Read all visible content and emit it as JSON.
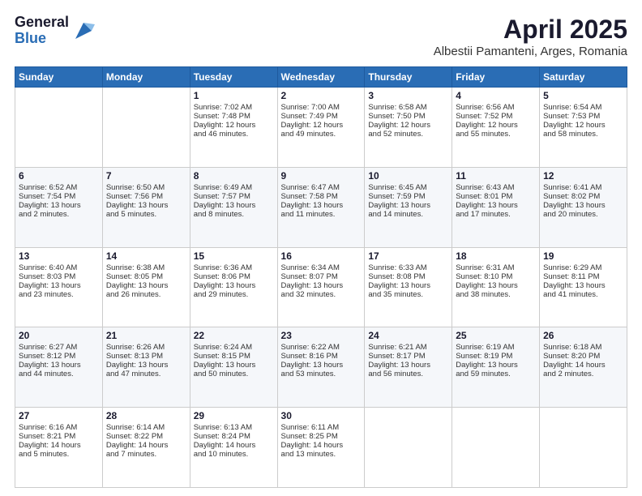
{
  "logo": {
    "general": "General",
    "blue": "Blue"
  },
  "header": {
    "title": "April 2025",
    "subtitle": "Albestii Pamanteni, Arges, Romania"
  },
  "weekdays": [
    "Sunday",
    "Monday",
    "Tuesday",
    "Wednesday",
    "Thursday",
    "Friday",
    "Saturday"
  ],
  "weeks": [
    [
      {
        "day": "",
        "info": ""
      },
      {
        "day": "",
        "info": ""
      },
      {
        "day": "1",
        "info": "Sunrise: 7:02 AM\nSunset: 7:48 PM\nDaylight: 12 hours\nand 46 minutes."
      },
      {
        "day": "2",
        "info": "Sunrise: 7:00 AM\nSunset: 7:49 PM\nDaylight: 12 hours\nand 49 minutes."
      },
      {
        "day": "3",
        "info": "Sunrise: 6:58 AM\nSunset: 7:50 PM\nDaylight: 12 hours\nand 52 minutes."
      },
      {
        "day": "4",
        "info": "Sunrise: 6:56 AM\nSunset: 7:52 PM\nDaylight: 12 hours\nand 55 minutes."
      },
      {
        "day": "5",
        "info": "Sunrise: 6:54 AM\nSunset: 7:53 PM\nDaylight: 12 hours\nand 58 minutes."
      }
    ],
    [
      {
        "day": "6",
        "info": "Sunrise: 6:52 AM\nSunset: 7:54 PM\nDaylight: 13 hours\nand 2 minutes."
      },
      {
        "day": "7",
        "info": "Sunrise: 6:50 AM\nSunset: 7:56 PM\nDaylight: 13 hours\nand 5 minutes."
      },
      {
        "day": "8",
        "info": "Sunrise: 6:49 AM\nSunset: 7:57 PM\nDaylight: 13 hours\nand 8 minutes."
      },
      {
        "day": "9",
        "info": "Sunrise: 6:47 AM\nSunset: 7:58 PM\nDaylight: 13 hours\nand 11 minutes."
      },
      {
        "day": "10",
        "info": "Sunrise: 6:45 AM\nSunset: 7:59 PM\nDaylight: 13 hours\nand 14 minutes."
      },
      {
        "day": "11",
        "info": "Sunrise: 6:43 AM\nSunset: 8:01 PM\nDaylight: 13 hours\nand 17 minutes."
      },
      {
        "day": "12",
        "info": "Sunrise: 6:41 AM\nSunset: 8:02 PM\nDaylight: 13 hours\nand 20 minutes."
      }
    ],
    [
      {
        "day": "13",
        "info": "Sunrise: 6:40 AM\nSunset: 8:03 PM\nDaylight: 13 hours\nand 23 minutes."
      },
      {
        "day": "14",
        "info": "Sunrise: 6:38 AM\nSunset: 8:05 PM\nDaylight: 13 hours\nand 26 minutes."
      },
      {
        "day": "15",
        "info": "Sunrise: 6:36 AM\nSunset: 8:06 PM\nDaylight: 13 hours\nand 29 minutes."
      },
      {
        "day": "16",
        "info": "Sunrise: 6:34 AM\nSunset: 8:07 PM\nDaylight: 13 hours\nand 32 minutes."
      },
      {
        "day": "17",
        "info": "Sunrise: 6:33 AM\nSunset: 8:08 PM\nDaylight: 13 hours\nand 35 minutes."
      },
      {
        "day": "18",
        "info": "Sunrise: 6:31 AM\nSunset: 8:10 PM\nDaylight: 13 hours\nand 38 minutes."
      },
      {
        "day": "19",
        "info": "Sunrise: 6:29 AM\nSunset: 8:11 PM\nDaylight: 13 hours\nand 41 minutes."
      }
    ],
    [
      {
        "day": "20",
        "info": "Sunrise: 6:27 AM\nSunset: 8:12 PM\nDaylight: 13 hours\nand 44 minutes."
      },
      {
        "day": "21",
        "info": "Sunrise: 6:26 AM\nSunset: 8:13 PM\nDaylight: 13 hours\nand 47 minutes."
      },
      {
        "day": "22",
        "info": "Sunrise: 6:24 AM\nSunset: 8:15 PM\nDaylight: 13 hours\nand 50 minutes."
      },
      {
        "day": "23",
        "info": "Sunrise: 6:22 AM\nSunset: 8:16 PM\nDaylight: 13 hours\nand 53 minutes."
      },
      {
        "day": "24",
        "info": "Sunrise: 6:21 AM\nSunset: 8:17 PM\nDaylight: 13 hours\nand 56 minutes."
      },
      {
        "day": "25",
        "info": "Sunrise: 6:19 AM\nSunset: 8:19 PM\nDaylight: 13 hours\nand 59 minutes."
      },
      {
        "day": "26",
        "info": "Sunrise: 6:18 AM\nSunset: 8:20 PM\nDaylight: 14 hours\nand 2 minutes."
      }
    ],
    [
      {
        "day": "27",
        "info": "Sunrise: 6:16 AM\nSunset: 8:21 PM\nDaylight: 14 hours\nand 5 minutes."
      },
      {
        "day": "28",
        "info": "Sunrise: 6:14 AM\nSunset: 8:22 PM\nDaylight: 14 hours\nand 7 minutes."
      },
      {
        "day": "29",
        "info": "Sunrise: 6:13 AM\nSunset: 8:24 PM\nDaylight: 14 hours\nand 10 minutes."
      },
      {
        "day": "30",
        "info": "Sunrise: 6:11 AM\nSunset: 8:25 PM\nDaylight: 14 hours\nand 13 minutes."
      },
      {
        "day": "",
        "info": ""
      },
      {
        "day": "",
        "info": ""
      },
      {
        "day": "",
        "info": ""
      }
    ]
  ]
}
